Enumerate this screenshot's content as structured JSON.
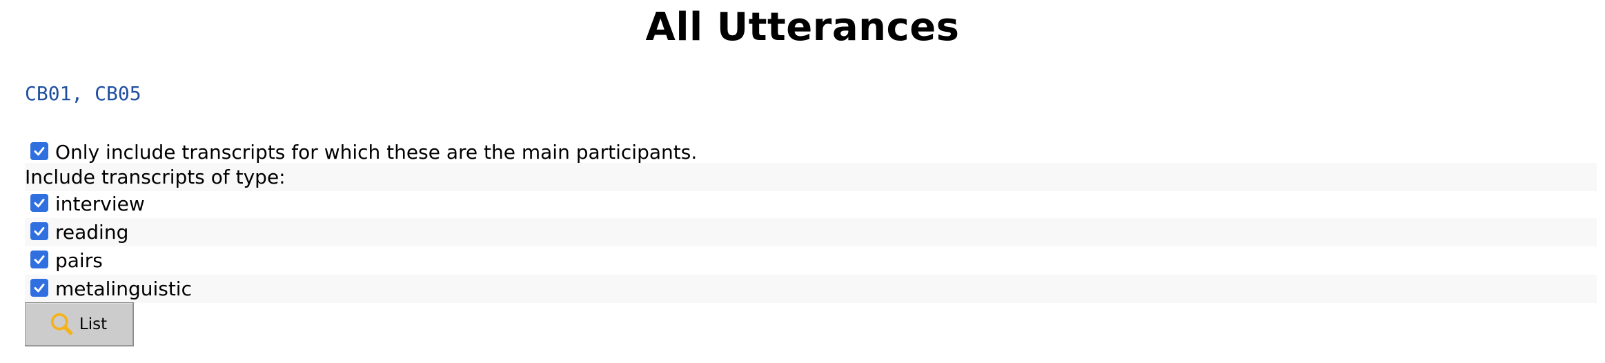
{
  "page": {
    "title": "All Utterances",
    "participants": "CB01, CB05"
  },
  "options": {
    "main_participants_label": "Only include transcripts for which these are the main participants.",
    "main_participants_checked": true,
    "types_heading": "Include transcripts of type:",
    "types": [
      {
        "label": "interview",
        "checked": true
      },
      {
        "label": "reading",
        "checked": true
      },
      {
        "label": "pairs",
        "checked": true
      },
      {
        "label": "metalinguistic",
        "checked": true
      }
    ]
  },
  "actions": {
    "list_label": "List",
    "list_icon": "magnifier-icon"
  },
  "colors": {
    "link": "#1f4ea0",
    "checkbox": "#2f6fe0",
    "button_bg": "#cccccc",
    "icon": "#f5b21a"
  }
}
